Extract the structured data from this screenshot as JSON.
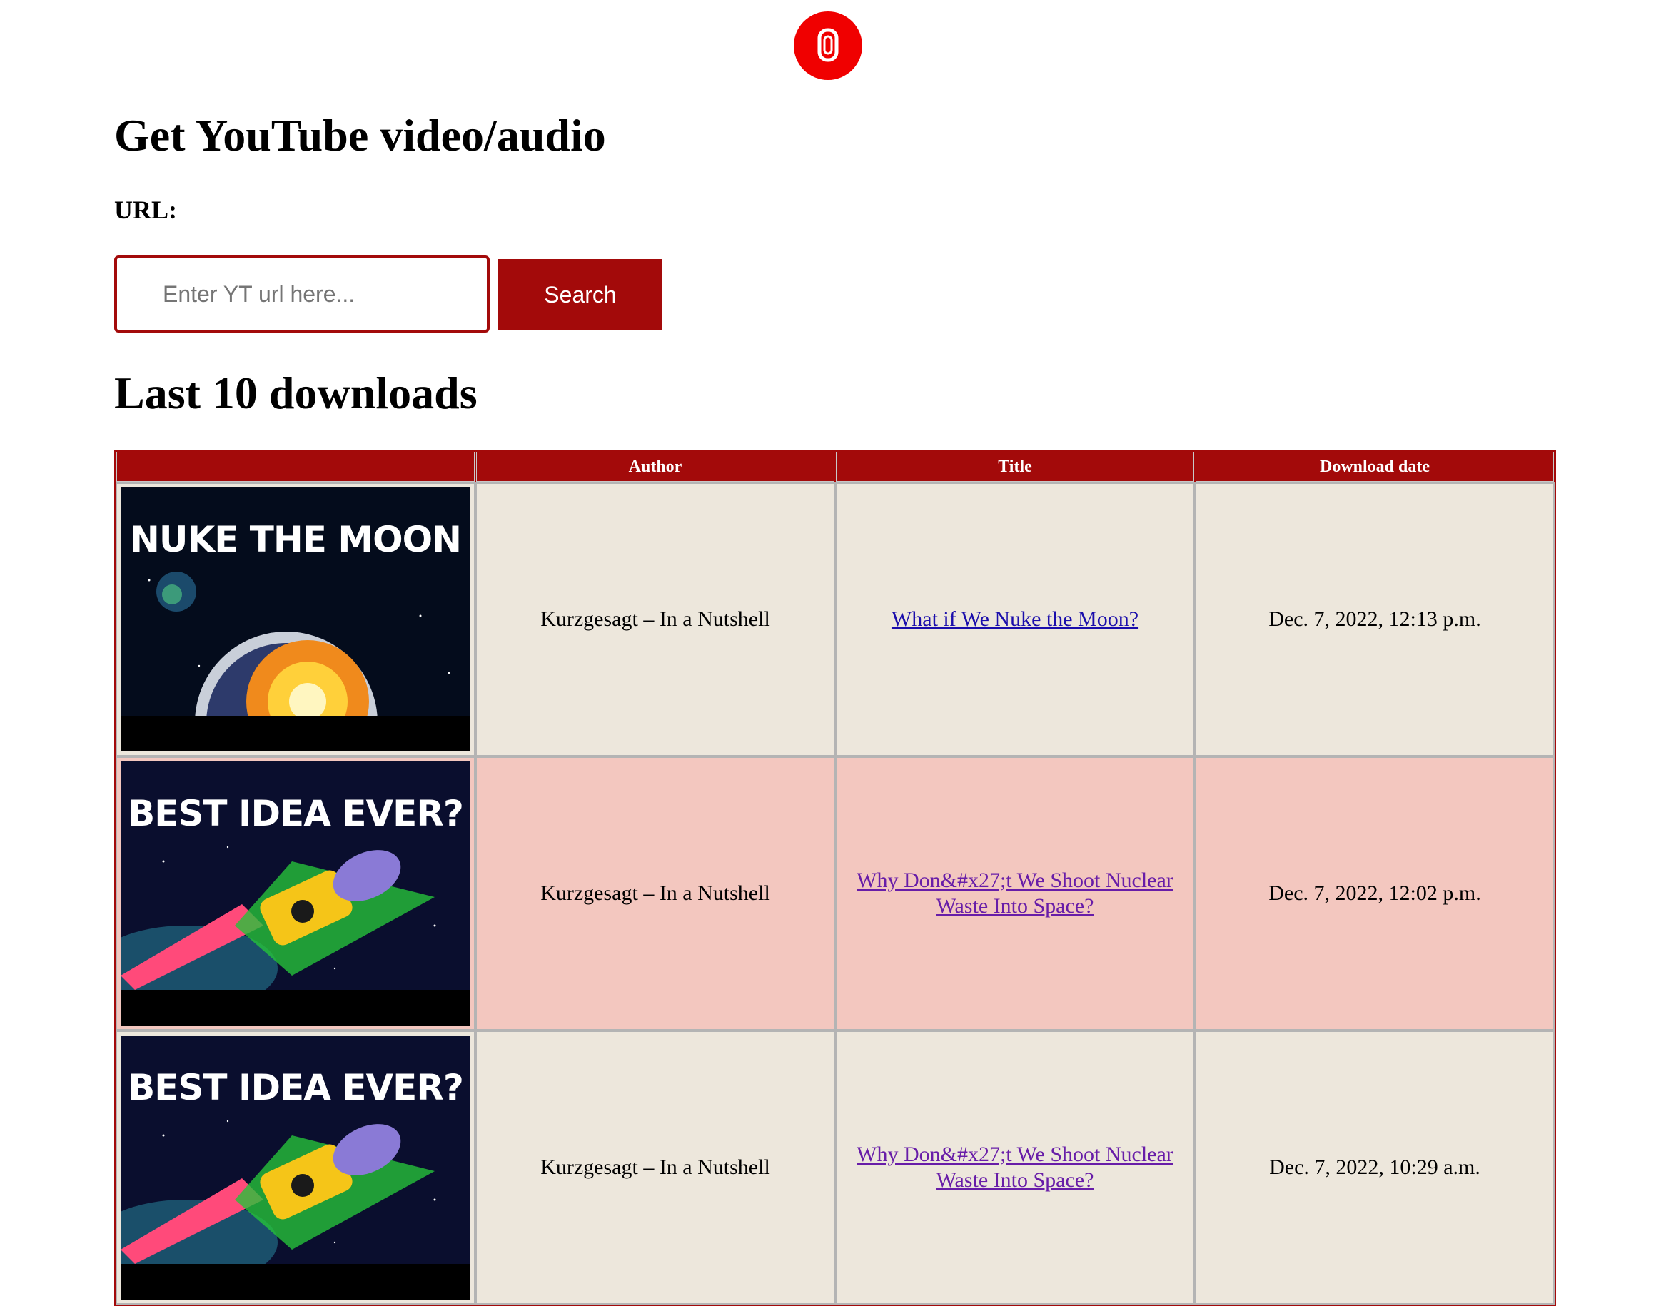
{
  "logo": {
    "icon": "youtube-circle-logo-icon",
    "color": "#f00000"
  },
  "heading": "Get YouTube video/audio",
  "url_label": "URL:",
  "search": {
    "placeholder": "Enter YT url here...",
    "value": "",
    "button_label": "Search"
  },
  "section_heading": "Last 10 downloads",
  "colors": {
    "accent": "#a30a0a",
    "row_light": "#ede7dc",
    "row_pink": "#f3c7bf",
    "link": "#1a0dab",
    "link_visited": "#681da8"
  },
  "table": {
    "headers": [
      "",
      "Author",
      "Title",
      "Download date"
    ],
    "rows": [
      {
        "thumbnail_caption": "NUKE THE MOON",
        "thumbnail_icon": "moon-explosion-thumbnail",
        "author": "Kurzgesagt – In a Nutshell",
        "title": "What if We Nuke the Moon?",
        "date": "Dec. 7, 2022, 12:13 p.m."
      },
      {
        "thumbnail_caption": "BEST IDEA EVER?",
        "thumbnail_icon": "nuclear-rocket-thumbnail",
        "author": "Kurzgesagt – In a Nutshell",
        "title": "Why Don&#x27;t We Shoot Nuclear Waste Into Space?",
        "date": "Dec. 7, 2022, 12:02 p.m."
      },
      {
        "thumbnail_caption": "BEST IDEA EVER?",
        "thumbnail_icon": "nuclear-rocket-thumbnail",
        "author": "Kurzgesagt – In a Nutshell",
        "title": "Why Don&#x27;t We Shoot Nuclear Waste Into Space?",
        "date": "Dec. 7, 2022, 10:29 a.m."
      }
    ]
  }
}
